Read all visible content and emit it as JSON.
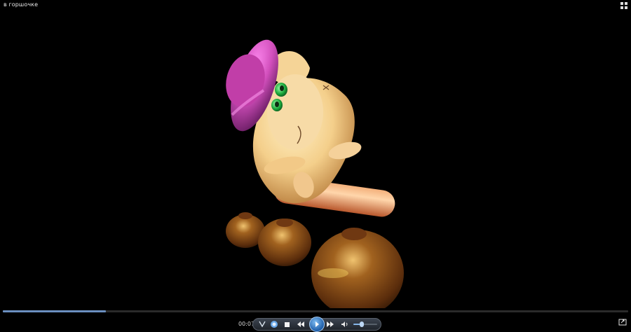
{
  "window": {
    "title": "в горшочке"
  },
  "player": {
    "time": "00:07",
    "progress": 0.165,
    "volume": 0.35
  },
  "icons": {
    "view_toggle": "view-toggle-icon",
    "switch_to_library": "switch-library-icon",
    "shuffle": "shuffle-icon",
    "repeat": "repeat-icon",
    "stop": "stop-icon",
    "previous": "previous-icon",
    "play": "play-icon",
    "next": "next-icon",
    "mute": "speaker-icon",
    "mini_mode": "mini-mode-icon"
  },
  "colors": {
    "accent": "#6b8fbf",
    "play_button": "#2c78c9"
  }
}
